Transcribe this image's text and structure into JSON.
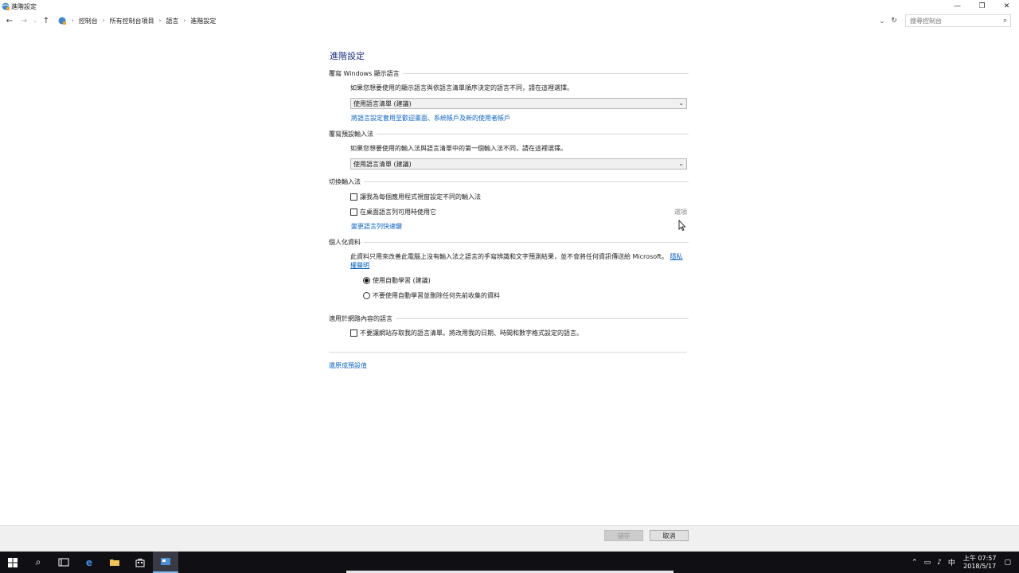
{
  "window": {
    "title": "進階設定",
    "controls": {
      "minimize": "—",
      "maximize": "❐",
      "close": "✕"
    }
  },
  "address": {
    "breadcrumbs": [
      "控制台",
      "所有控制台項目",
      "語言",
      "進階設定"
    ],
    "separator": "›",
    "search_placeholder": "搜尋控制台"
  },
  "page": {
    "title": "進階設定",
    "sections": {
      "display_lang": {
        "heading": "覆寫 Windows 顯示語言",
        "desc": "如果您想要使用的顯示語言與依語言清單順序決定的語言不同，請在這裡選擇。",
        "select_value": "使用語言清單 (建議)",
        "link": "將語言設定套用至歡迎畫面、系統帳戶及新的使用者帳戶"
      },
      "default_input": {
        "heading": "覆寫預設輸入法",
        "desc": "如果您想要使用的輸入法與語言清單中的第一個輸入法不同，請在這裡選擇。",
        "select_value": "使用語言清單 (建議)"
      },
      "switch_input": {
        "heading": "切換輸入法",
        "check1": "讓我為每個應用程式視窗設定不同的輸入法",
        "check2": "在桌面語言列可用時使用它",
        "options_link": "選項",
        "link": "變更語言列快速鍵"
      },
      "personalization": {
        "heading": "個人化資料",
        "desc": "此資料只用來改善此電腦上沒有輸入法之語言的手寫辨識和文字預測結果，並不會將任何資訊傳送給 Microsoft。",
        "privacy_link": "隱私權聲明",
        "radio1": "使用自動學習 (建議)",
        "radio2": "不要使用自動學習並刪除任何先前收集的資料",
        "radio1_selected": true
      },
      "web_lang": {
        "heading": "適用於網路內容的語言",
        "check": "不要讓網站存取我的語言清單。將改用我的日期、時間和數字格式設定的語言。"
      }
    },
    "restore_link": "還原成預設值"
  },
  "footer": {
    "save": "儲存",
    "cancel": "取消"
  },
  "taskbar": {
    "ime": "中",
    "time": "上午 07:57",
    "date": "2018/5/17"
  }
}
